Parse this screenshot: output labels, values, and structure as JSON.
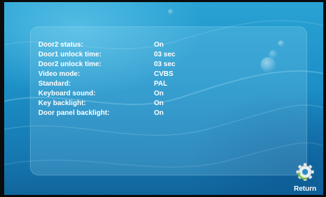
{
  "settings": {
    "rows": [
      {
        "label": "Door2 status:",
        "value": "On"
      },
      {
        "label": "Door1 unlock time:",
        "value": "03 sec"
      },
      {
        "label": "Door2 unlock time:",
        "value": "03 sec"
      },
      {
        "label": "Video mode:",
        "value": "CVBS"
      },
      {
        "label": "Standard:",
        "value": "PAL"
      },
      {
        "label": "Keyboard sound:",
        "value": "On"
      },
      {
        "label": "Key backlight:",
        "value": "On"
      },
      {
        "label": "Door panel backlight:",
        "value": "On"
      }
    ]
  },
  "return_button": {
    "label": "Return",
    "icon": "gear-icon"
  },
  "colors": {
    "background": "#1c8fc6",
    "text": "#ffffff",
    "return_icon": "#e8eef2",
    "return_arrow": "#7cc23a"
  }
}
